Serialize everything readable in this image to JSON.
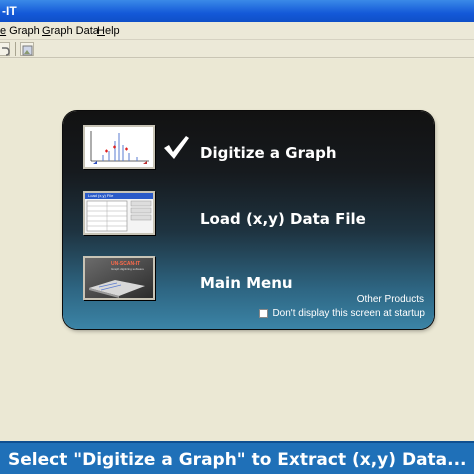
{
  "window": {
    "title": "-IT"
  },
  "menu": {
    "items": [
      {
        "prefix": "",
        "ul": "e",
        "rest": " Graph"
      },
      {
        "prefix": "",
        "ul": "G",
        "rest": "raph Data"
      },
      {
        "prefix": "",
        "ul": "H",
        "rest": "elp"
      }
    ]
  },
  "dialog": {
    "options": [
      {
        "label": "Digitize a Graph",
        "checked": true
      },
      {
        "label": "Load (x,y) Data File",
        "checked": false
      },
      {
        "label": "Main Menu",
        "checked": false
      }
    ],
    "thumb2": {
      "title": "Load (x,y) File"
    },
    "thumb3": {
      "brand": "UN-SCAN-IT",
      "tagline": "Graph digitizing software"
    },
    "other_products": "Other Products",
    "startup_checkbox": "Don't display this screen at startup"
  },
  "banner": {
    "text": "Select \"Digitize a Graph\" to Extract (x,y) Data..."
  },
  "colors": {
    "banner_bg": "#1f70b8",
    "accent": "#3b84a6",
    "titlebar": "#1459d8"
  }
}
